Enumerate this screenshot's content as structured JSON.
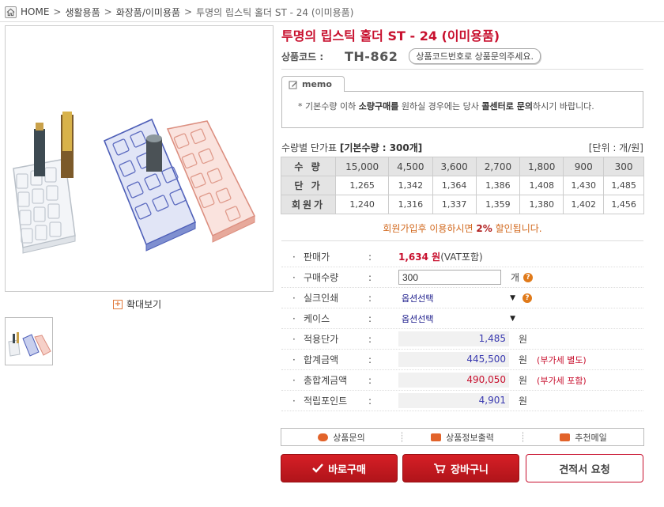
{
  "breadcrumb": {
    "home": "HOME",
    "items": [
      "생활용품",
      "화장품/이미용품"
    ],
    "current": "투명의 립스틱 홀더 ST - 24 (이미용품)",
    "separator": ">"
  },
  "gallery": {
    "zoom_label": "확대보기",
    "main_image_icon": "product-photo",
    "thumbnail_count": 1
  },
  "product": {
    "title": "투명의 립스틱 홀더 ST - 24 (이미용품)",
    "code_label": "상품코드 :",
    "code_value": "TH-862",
    "code_note": "상품코드번호로 상품문의주세요."
  },
  "memo": {
    "tab_label": "memo",
    "bullet": "*",
    "text_1": "기본수량 이하 ",
    "bold_1": "소량구매를",
    "text_2": " 원하실 경우에는 당사 ",
    "bold_2": "콜센터로 문의",
    "text_3": "하시기 바랍니다."
  },
  "price_table": {
    "heading": "수량별 단가표",
    "base_qty": "[기본수량 : 300개]",
    "unit_note": "[단위 : 개/원]",
    "rows": [
      {
        "label": "수 량",
        "values": [
          "15,000",
          "4,500",
          "3,600",
          "2,700",
          "1,800",
          "900",
          "300"
        ]
      },
      {
        "label": "단 가",
        "values": [
          "1,265",
          "1,342",
          "1,364",
          "1,386",
          "1,408",
          "1,430",
          "1,485"
        ]
      },
      {
        "label": "회원가",
        "values": [
          "1,240",
          "1,316",
          "1,337",
          "1,359",
          "1,380",
          "1,402",
          "1,456"
        ]
      }
    ]
  },
  "discount": {
    "text_1": "회원가입후 이용하시면 ",
    "percent": "2%",
    "text_2": " 할인됩니다."
  },
  "spec": {
    "bullet": "·",
    "colon": ":",
    "sale_price": {
      "label": "판매가",
      "value": "1,634 원",
      "vat": "(VAT포함)"
    },
    "quantity": {
      "label": "구매수량",
      "value": "300",
      "unit": "개"
    },
    "silk_print": {
      "label": "실크인쇄",
      "selected": "옵션선택"
    },
    "case": {
      "label": "케이스",
      "selected": "옵션선택"
    },
    "unit_price": {
      "label": "적용단가",
      "value": "1,485",
      "unit": "원"
    },
    "subtotal": {
      "label": "합계금액",
      "value": "445,500",
      "unit": "원",
      "note": "(부가세 별도)"
    },
    "total": {
      "label": "총합계금액",
      "value": "490,050",
      "unit": "원",
      "note": "(부가세 포함)"
    },
    "points": {
      "label": "적립포인트",
      "value": "4,901",
      "unit": "원"
    },
    "help_mark": "?",
    "arrow": "▼"
  },
  "actions": {
    "inquiry": "상품문의",
    "print": "상품정보출력",
    "recommend": "추천메일"
  },
  "buttons": {
    "buy_now": "바로구매",
    "cart": "장바구니",
    "quote": "견적서 요청"
  },
  "colors": {
    "accent": "#c8102e",
    "discount": "#d2691e",
    "value_blue": "#3a3ab0"
  }
}
